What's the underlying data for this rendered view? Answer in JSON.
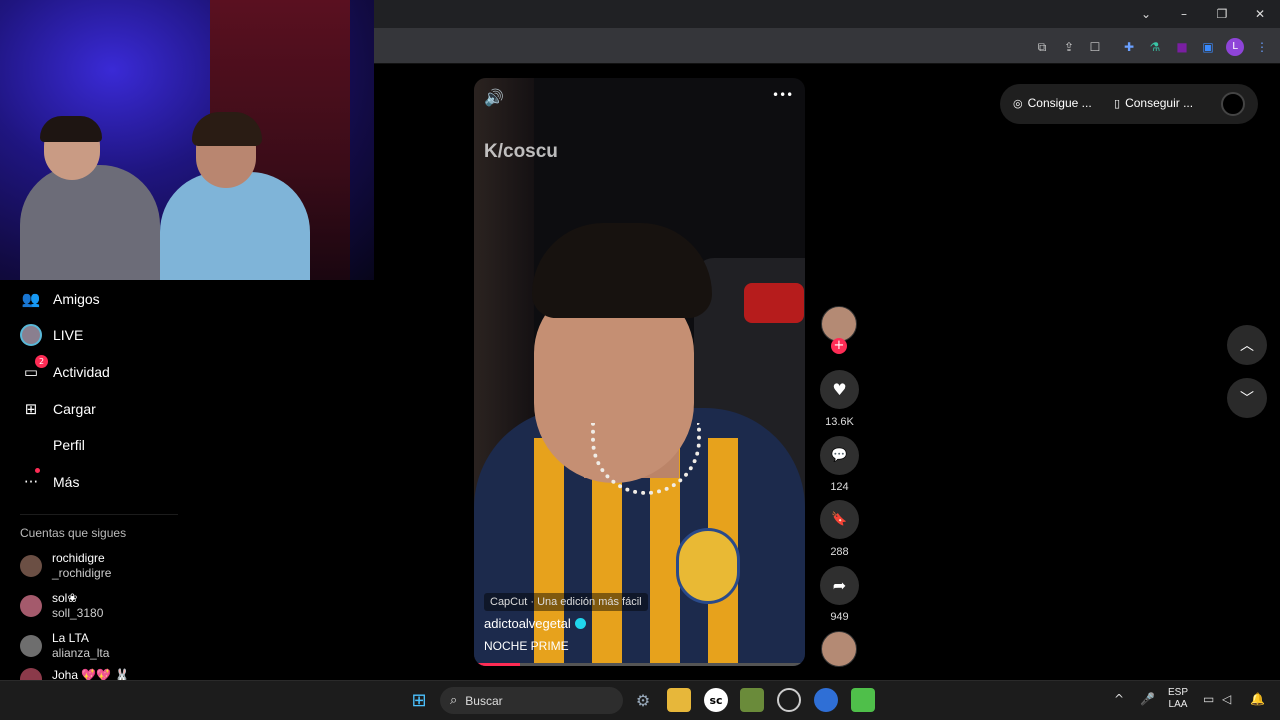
{
  "browser": {
    "window_controls": {
      "tabs_dropdown": "⌄",
      "minimize": "–",
      "restore": "❐",
      "close": "✕"
    },
    "toolbar_icons": [
      "open-in-new",
      "share",
      "bookmark",
      "extensions",
      "flask",
      "extension-purple",
      "side-panel"
    ],
    "profile_initial": "L",
    "menu": "⋮"
  },
  "sidebar": {
    "items": [
      {
        "label": "Amigos",
        "icon": "friends-icon"
      },
      {
        "label": "LIVE",
        "icon": "live-icon"
      },
      {
        "label": "Actividad",
        "icon": "activity-icon",
        "badge": "2"
      },
      {
        "label": "Cargar",
        "icon": "upload-icon"
      },
      {
        "label": "Perfil",
        "icon": "profile-icon"
      },
      {
        "label": "Más",
        "icon": "more-icon"
      }
    ],
    "following_title": "Cuentas que sigues",
    "following": [
      {
        "name": "rochidigre",
        "handle": "_rochidigre"
      },
      {
        "name": "sol❀",
        "handle": "soll_3180"
      },
      {
        "name": "La LTA",
        "handle": "alianza_lta"
      },
      {
        "name": "Joha 💖💖 🐰",
        "handle": ""
      }
    ]
  },
  "video": {
    "watermark": "K/coscu",
    "capcut": "CapCut · Una edición más fácil",
    "author": "adictoalvegetal",
    "description": "NOCHE PRIME",
    "progress": 0.14,
    "mute_icon": "🔊",
    "more_icon": "•••"
  },
  "actions": {
    "likes": "13.6K",
    "comments": "124",
    "saves": "288",
    "shares": "949",
    "like_icon": "♥",
    "comment_icon": "💬",
    "save_icon": "🔖",
    "share_icon": "➦",
    "follow_plus": "+"
  },
  "top_pill": {
    "item1": "Consigue ...",
    "item2": "Conseguir ..."
  },
  "nav": {
    "up": "︿",
    "down": "﹀"
  },
  "taskbar": {
    "search_placeholder": "Buscar",
    "search_icon": "⌕",
    "language": "ESP",
    "layout": "LAA",
    "tray_chevron": "^",
    "mic": "🎤",
    "notification": "🔔"
  }
}
